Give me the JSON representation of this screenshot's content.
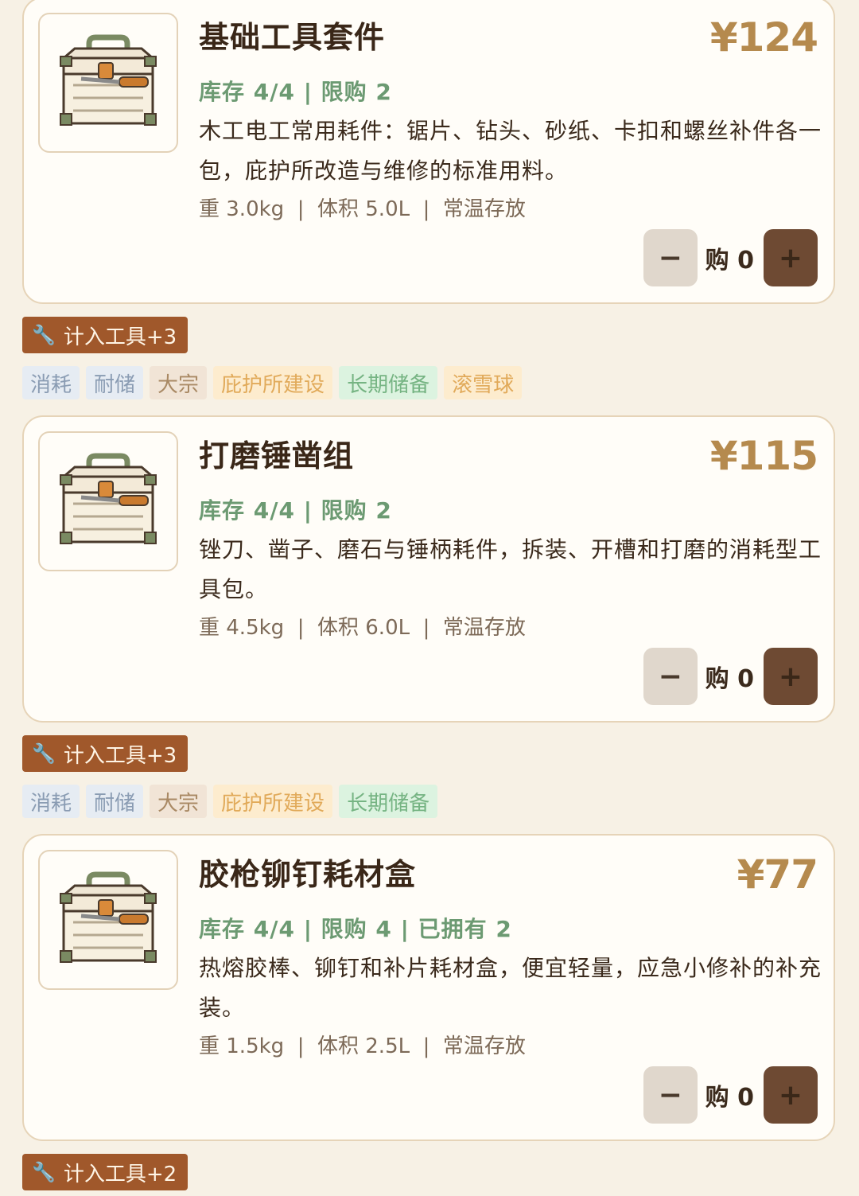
{
  "products": [
    {
      "title": "基础工具套件",
      "price": "¥124",
      "stock": "库存 4/4 | 限购 2",
      "description": "木工电工常用耗件：锯片、钻头、砂纸、卡扣和螺丝补件各一包，庇护所改造与维修的标准用料。",
      "specs": "重 3.0kg  |  体积 5.0L  |  常温存放",
      "qty_label": "购 0",
      "tool_tag": "计入工具+3",
      "image_icon": "toolbox-icon",
      "tags": [
        "消耗",
        "耐储",
        "大宗",
        "庇护所建设",
        "长期储备",
        "滚雪球"
      ]
    },
    {
      "title": "打磨锤凿组",
      "price": "¥115",
      "stock": "库存 4/4 | 限购 2",
      "description": "锉刀、凿子、磨石与锤柄耗件，拆装、开槽和打磨的消耗型工具包。",
      "specs": "重 4.5kg  |  体积 6.0L  |  常温存放",
      "qty_label": "购 0",
      "tool_tag": "计入工具+3",
      "image_icon": "toolbox-icon",
      "tags": [
        "消耗",
        "耐储",
        "大宗",
        "庇护所建设",
        "长期储备"
      ]
    },
    {
      "title": "胶枪铆钉耗材盒",
      "price": "¥77",
      "stock": "库存 4/4 | 限购 4 | 已拥有 2",
      "description": "热熔胶棒、铆钉和补片耗材盒，便宜轻量，应急小修补的补充装。",
      "specs": "重 1.5kg  |  体积 2.5L  |  常温存放",
      "qty_label": "购 0",
      "tool_tag": "计入工具+2",
      "image_icon": "toolbox-icon",
      "tags": []
    }
  ],
  "controls": {
    "minus": "−",
    "plus": "+",
    "wrench_icon": "wrench-icon"
  },
  "colors": {
    "price": "#b58a4e",
    "stock": "#6c9a72",
    "tool_chip": "#a0582b",
    "plus_button": "#6e4a33",
    "minus_button": "#e0d7cc"
  }
}
